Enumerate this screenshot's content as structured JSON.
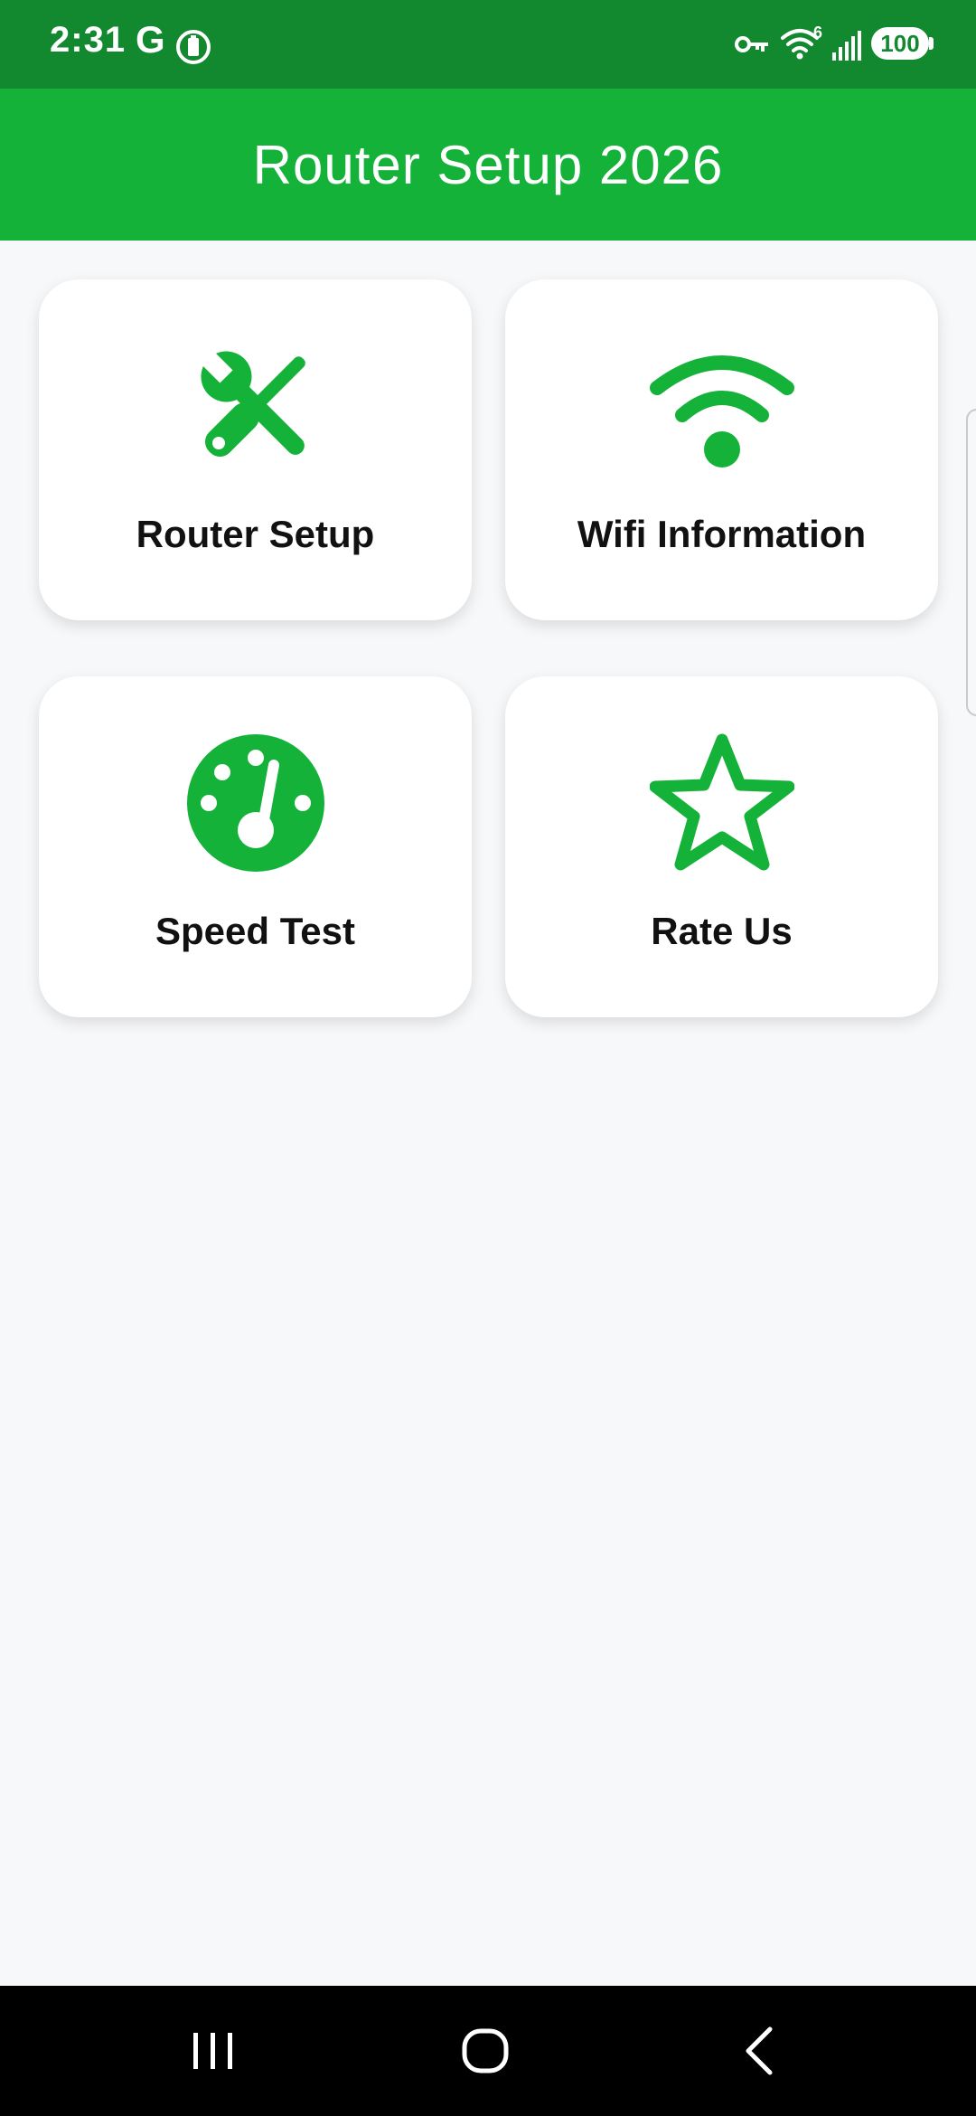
{
  "status_bar": {
    "time": "2:31",
    "carrier_glyph": "G",
    "battery_level": "100",
    "wifi_superscript": "6",
    "icons": [
      "google-g-icon",
      "battery-saver-icon",
      "vpn-key-icon",
      "wifi-icon",
      "cell-signal-icon",
      "battery-icon"
    ]
  },
  "app_bar": {
    "title": "Router Setup 2026"
  },
  "menu": {
    "items": [
      {
        "label": "Router Setup",
        "icon": "tools-icon"
      },
      {
        "label": "Wifi Information",
        "icon": "wifi-icon"
      },
      {
        "label": "Speed Test",
        "icon": "speedometer-icon"
      },
      {
        "label": "Rate Us",
        "icon": "star-outline-icon"
      }
    ]
  },
  "nav_bar": {
    "buttons": [
      "recents-icon",
      "home-icon",
      "back-icon"
    ]
  },
  "colors": {
    "status_bar": "#12882f",
    "app_bar": "#15b23a",
    "accent": "#15b23a",
    "background": "#f7f8fa",
    "card": "#ffffff",
    "nav_bar": "#000000"
  }
}
